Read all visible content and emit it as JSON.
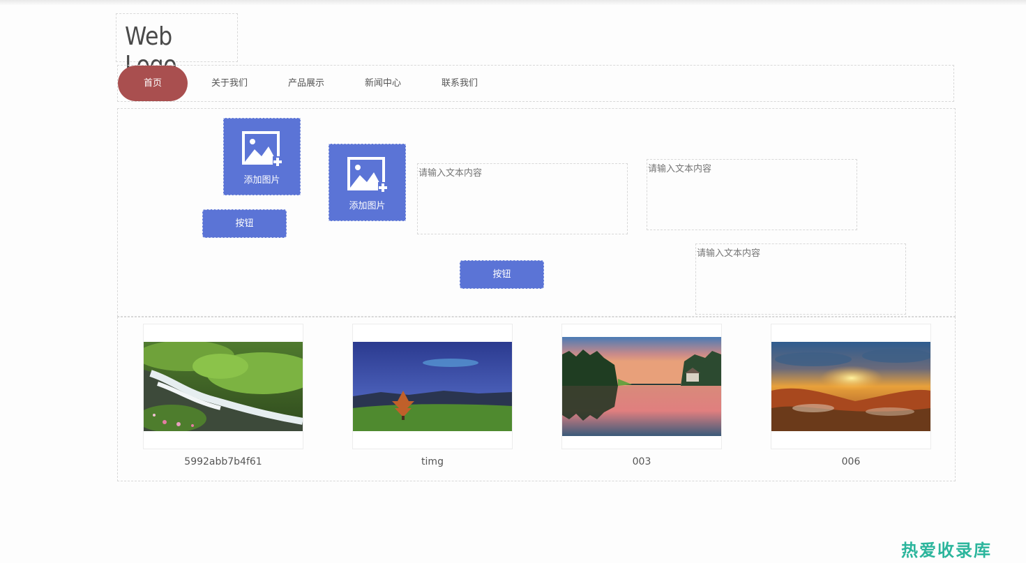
{
  "logo": {
    "text": "Web Logo"
  },
  "nav": {
    "items": [
      {
        "label": "首页",
        "active": true
      },
      {
        "label": "关于我们"
      },
      {
        "label": "产品展示"
      },
      {
        "label": "新闻中心"
      },
      {
        "label": "联系我们"
      }
    ]
  },
  "editor": {
    "add_image_label": "添加图片",
    "button_label": "按钮",
    "textarea_placeholder": "请输入文本内容"
  },
  "gallery": {
    "items": [
      {
        "caption": "5992abb7b4f61"
      },
      {
        "caption": "timg"
      },
      {
        "caption": "003"
      },
      {
        "caption": "006"
      }
    ]
  },
  "watermark": {
    "text": "热爱收录库"
  },
  "colors": {
    "accent_blue": "#5b74d6",
    "nav_active": "#a94f4f",
    "watermark": "#2bb59c"
  }
}
